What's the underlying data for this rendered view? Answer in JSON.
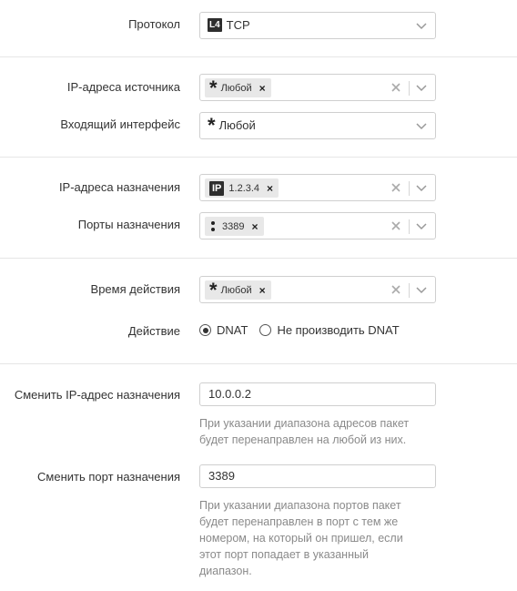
{
  "protocol": {
    "label": "Протокол",
    "badge": "L4",
    "value": "TCP"
  },
  "source_ip": {
    "label": "IP-адреса источника",
    "tag": "Любой"
  },
  "incoming_interface": {
    "label": "Входящий интерфейс",
    "value": "Любой"
  },
  "dest_ip": {
    "label": "IP-адреса назначения",
    "badge": "IP",
    "tag": "1.2.3.4"
  },
  "dest_ports": {
    "label": "Порты назначения",
    "tag": "3389"
  },
  "schedule": {
    "label": "Время действия",
    "tag": "Любой"
  },
  "action": {
    "label": "Действие",
    "option_dnat": "DNAT",
    "option_no_dnat": "Не производить DNAT",
    "selected": "DNAT"
  },
  "change_dest_ip": {
    "label": "Сменить IP-адрес назначения",
    "value": "10.0.0.2",
    "hint_lines": [
      "При указании диапазона адресов пакет",
      "будет перенаправлен на любой из них."
    ]
  },
  "change_dest_port": {
    "label": "Сменить порт назначения",
    "value": "3389",
    "hint_lines": [
      "При указании диапазона портов пакет",
      "будет перенаправлен в порт с тем же",
      "номером, на который он пришел, если",
      "этот порт попадает в указанный",
      "диапазон."
    ]
  },
  "icons": {
    "remove": "close-icon",
    "clear": "clear-icon",
    "dropdown": "chevron-down-icon"
  },
  "colors": {
    "hint": "#8a8a8a",
    "badge_bg": "#2e2e2e",
    "border": "#cfcfcf"
  }
}
